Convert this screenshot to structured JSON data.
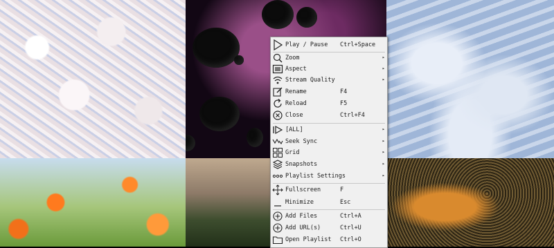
{
  "menu": {
    "items": [
      {
        "label": "Play / Pause",
        "shortcut": "Ctrl+Space",
        "icon": "play-icon"
      },
      {
        "label": "Zoom",
        "submenu": true,
        "icon": "zoom-icon"
      },
      {
        "label": "Aspect",
        "submenu": true,
        "icon": "aspect-icon"
      },
      {
        "label": "Stream Quality",
        "submenu": true,
        "icon": "wifi-icon"
      },
      {
        "label": "Rename",
        "shortcut": "F4",
        "icon": "rename-icon"
      },
      {
        "label": "Reload",
        "shortcut": "F5",
        "icon": "reload-icon"
      },
      {
        "label": "Close",
        "shortcut": "Ctrl+F4",
        "icon": "close-icon"
      },
      {
        "label": "[ALL]",
        "submenu": true,
        "icon": "play-all-icon"
      },
      {
        "label": "Seek Sync",
        "submenu": true,
        "icon": "seek-sync-icon"
      },
      {
        "label": "Grid",
        "submenu": true,
        "icon": "grid-icon"
      },
      {
        "label": "Snapshots",
        "submenu": true,
        "icon": "layers-icon"
      },
      {
        "label": "Playlist Settings",
        "submenu": true,
        "icon": "dots-icon"
      },
      {
        "label": "Fullscreen",
        "shortcut": "F",
        "icon": "fullscreen-icon"
      },
      {
        "label": "Minimize",
        "shortcut": "Esc",
        "icon": "minimize-icon"
      },
      {
        "label": "Add Files",
        "shortcut": "Ctrl+A",
        "icon": "add-files-icon"
      },
      {
        "label": "Add URL(s)",
        "shortcut": "Ctrl+U",
        "icon": "add-url-icon"
      },
      {
        "label": "Open Playlist",
        "shortcut": "Ctrl+O",
        "icon": "folder-icon"
      }
    ],
    "submenu_arrow": "▸"
  }
}
